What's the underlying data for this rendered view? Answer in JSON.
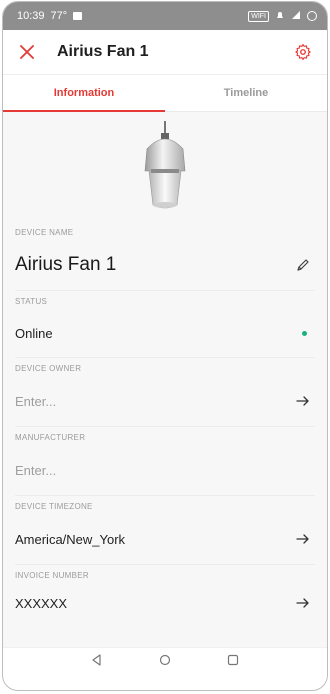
{
  "status_bar": {
    "time": "10:39",
    "temp": "77°",
    "badge": "WIFI"
  },
  "header": {
    "title": "Airius Fan 1"
  },
  "tabs": [
    {
      "label": "Information",
      "active": true
    },
    {
      "label": "Timeline",
      "active": false
    }
  ],
  "fields": {
    "device_name": {
      "label": "DEVICE NAME",
      "value": "Airius Fan 1"
    },
    "status": {
      "label": "STATUS",
      "value": "Online"
    },
    "device_owner": {
      "label": "DEVICE OWNER",
      "placeholder": "Enter..."
    },
    "manufacturer": {
      "label": "MANUFACTURER",
      "placeholder": "Enter..."
    },
    "device_timezone": {
      "label": "DEVICE TIMEZONE",
      "value": "America/New_York"
    },
    "invoice_number": {
      "label": "INVOICE NUMBER",
      "value": "XXXXXX"
    }
  },
  "colors": {
    "accent": "#e53935",
    "online": "#18b37a"
  },
  "icons": {
    "close": "close-icon",
    "settings": "gear-icon",
    "edit": "pencil-icon",
    "arrow": "arrow-right-icon"
  }
}
